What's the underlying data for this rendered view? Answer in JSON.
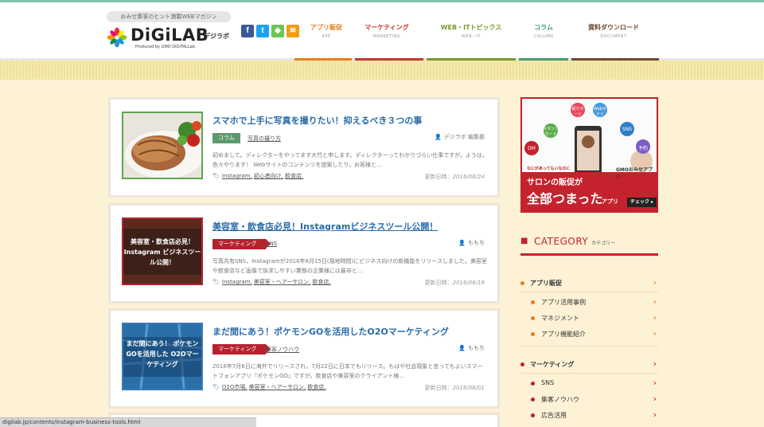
{
  "header": {
    "tagline": "おみせ集客のヒント満載WEBマガジン",
    "logo_text": "DiGiLAB",
    "logo_sub": "デジラボ",
    "logo_produced": "Produced by GMO DIGITALLab",
    "social": [
      {
        "name": "facebook-icon",
        "glyph": "f",
        "color": "#3b5998"
      },
      {
        "name": "twitter-icon",
        "glyph": "t",
        "color": "#1da1f2"
      },
      {
        "name": "feedly-icon",
        "glyph": "◆",
        "color": "#6cc655"
      },
      {
        "name": "rss-icon",
        "glyph": "≋",
        "color": "#f39c12"
      }
    ],
    "nav": [
      {
        "label": "アプリ販促",
        "sub": "APP",
        "color": "#e67e22"
      },
      {
        "label": "マーケティング",
        "sub": "MARKETING",
        "color": "#c0392b"
      },
      {
        "label": "WEB・ITトピックス",
        "sub": "WEB・IT",
        "color": "#7a9b2b"
      },
      {
        "label": "コラム",
        "sub": "COLUMN",
        "color": "#4a9b6f"
      },
      {
        "label": "資料ダウンロード",
        "sub": "DOCUMENT",
        "color": "#6b4a2e"
      }
    ]
  },
  "articles": [
    {
      "title": "スマホで上手に写真を撮りたい！抑えるべき３つの事",
      "category": "コラム",
      "subcategory": "写真の撮り方",
      "author": "デジラボ 編集部",
      "excerpt": "初めまして。ディレクターをやってます大竹と申します。ディレクターってわかりづらい仕事ですが，ようは，色々やります！ Webサイトのコンテンツを提案したり，お客様と...",
      "tags": [
        "Instagram,",
        "初心者向け,",
        "飲食店,"
      ],
      "date_label": "更新日時：",
      "date": "2016/08/24"
    },
    {
      "title": "美容室・飲食店必見！Instagramビジネスツール公開！",
      "category": "マーケティング",
      "subcategory": "SNS",
      "author": "ももち",
      "excerpt": "写真共有SNS，Instagramが2016年8月15日(現地時間)にビジネス向けの新機能をリリースしました。美容室や飲食店など画像で訴求しやすい業態の企業様には最非と...",
      "tags": [
        "Instagram,",
        "美容室・ヘアーサロン,",
        "飲食店,"
      ],
      "date_label": "更新日時：",
      "date": "2016/08/16",
      "thumb_text": "美容室・飲食店必見！ Instagram ビジネスツール公開！"
    },
    {
      "title": "まだ間にあう！ポケモンGOを活用したO2Oマーケティング",
      "category": "マーケティング",
      "subcategory": "集客ノウハウ",
      "author": "ももち",
      "excerpt": "2016年7月6日に海外でリリースされ，7月22日に日本でもリリース。もはや社会現象と言ってもよいスマートフォンアプリ『ポケモンGO』ですが，飲食店や美容室のクライアント様...",
      "tags": [
        "O2O市場,",
        "美容室・ヘアーサロン,",
        "飲食店,"
      ],
      "date_label": "更新日時：",
      "date": "2016/08/01",
      "thumb_text": "まだ間にあう！ ポケモンGOを活用した O2Oマーケティング"
    }
  ],
  "banner": {
    "icons": [
      "紹介カード",
      "Webサイト",
      "スタンプカード",
      "SNS",
      "DM",
      "予約"
    ],
    "tagline": "なにがあってもいなのに",
    "headline_small": "サロンの販促が",
    "headline_big": "全部つまった",
    "headline_tail": "アプリ",
    "brand": "GMOおみせアプリ",
    "cta": "チェック ▸"
  },
  "sidebar": {
    "category_title": "CATEGORY",
    "category_sub": "カテゴリー",
    "groups": [
      {
        "label": "アプリ販促",
        "color": "#e67e22",
        "items": [
          "アプリ活用事例",
          "マネジメント",
          "アプリ機能紹介"
        ]
      },
      {
        "label": "マーケティング",
        "color": "#b5222e",
        "items": [
          "SNS",
          "集客ノウハウ",
          "広告活用"
        ]
      }
    ]
  },
  "status_bar": "digilab.jp/contents/instagram-business-tools.html"
}
